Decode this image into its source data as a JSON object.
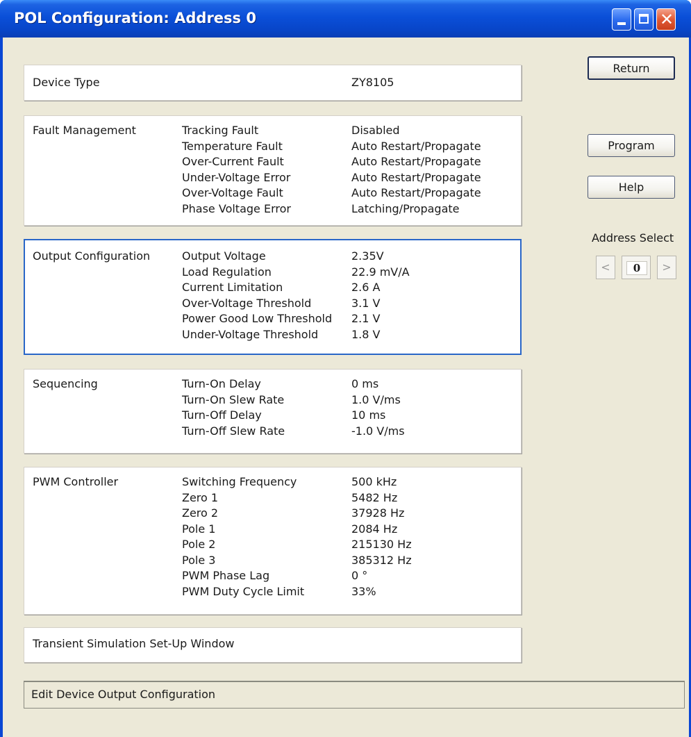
{
  "window": {
    "title": "POL Configuration: Address 0"
  },
  "device": {
    "label": "Device Type",
    "value": "ZY8105"
  },
  "fault": {
    "title": "Fault Management",
    "rows": [
      {
        "label": "Tracking Fault",
        "value": "Disabled"
      },
      {
        "label": "Temperature Fault",
        "value": "Auto Restart/Propagate"
      },
      {
        "label": "Over-Current Fault",
        "value": "Auto Restart/Propagate"
      },
      {
        "label": "Under-Voltage Error",
        "value": "Auto Restart/Propagate"
      },
      {
        "label": "Over-Voltage Fault",
        "value": "Auto Restart/Propagate"
      },
      {
        "label": "Phase Voltage Error",
        "value": "Latching/Propagate"
      }
    ]
  },
  "output": {
    "title": "Output Configuration",
    "rows": [
      {
        "label": "Output Voltage",
        "value": "2.35V"
      },
      {
        "label": "Load Regulation",
        "value": "22.9 mV/A"
      },
      {
        "label": "Current Limitation",
        "value": "2.6 A"
      },
      {
        "label": "Over-Voltage Threshold",
        "value": "3.1 V"
      },
      {
        "label": "Power Good Low Threshold",
        "value": "2.1 V"
      },
      {
        "label": "Under-Voltage Threshold",
        "value": "1.8 V"
      }
    ]
  },
  "sequencing": {
    "title": "Sequencing",
    "rows": [
      {
        "label": "Turn-On Delay",
        "value": "0 ms"
      },
      {
        "label": "Turn-On Slew Rate",
        "value": "1.0 V/ms"
      },
      {
        "label": "Turn-Off Delay",
        "value": "10 ms"
      },
      {
        "label": "Turn-Off Slew Rate",
        "value": "-1.0 V/ms"
      }
    ]
  },
  "pwm": {
    "title": "PWM Controller",
    "rows": [
      {
        "label": "Switching Frequency",
        "value": "500 kHz"
      },
      {
        "label": "Zero 1",
        "value": "5482 Hz"
      },
      {
        "label": "Zero 2",
        "value": "37928 Hz"
      },
      {
        "label": "Pole 1",
        "value": "2084 Hz"
      },
      {
        "label": "Pole 2",
        "value": "215130 Hz"
      },
      {
        "label": "Pole 3",
        "value": "385312 Hz"
      },
      {
        "label": "PWM Phase Lag",
        "value": "0 °"
      },
      {
        "label": "PWM Duty Cycle Limit",
        "value": "33%"
      }
    ]
  },
  "transient": {
    "title": "Transient Simulation Set-Up Window"
  },
  "buttons": {
    "return": "Return",
    "program": "Program",
    "help": "Help"
  },
  "address_select": {
    "label": "Address Select",
    "prev": "<",
    "value": "0",
    "next": ">"
  },
  "status": {
    "text": "Edit Device Output Configuration"
  },
  "colors": {
    "titlebar": "#0a4fd8",
    "client_bg": "#ece9d8",
    "selected_border": "#2966c8"
  },
  "icons": {
    "minimize": "minimize-icon",
    "maximize": "maximize-icon",
    "close": "close-icon"
  }
}
